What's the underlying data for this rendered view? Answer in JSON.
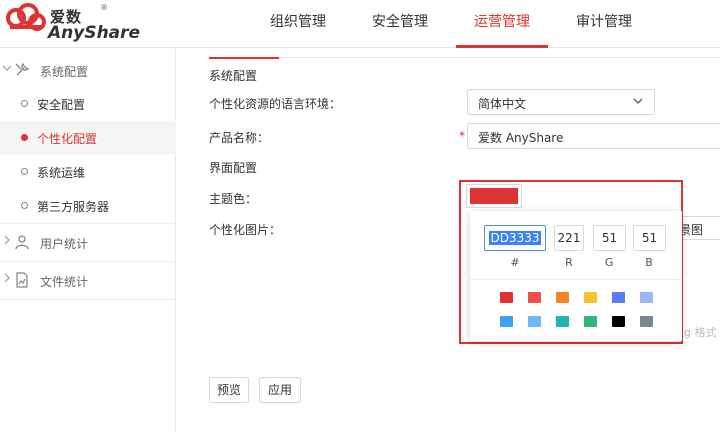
{
  "app": {
    "logo_cn": "爱数",
    "logo_en": "AnyShare",
    "logo_reg": "®"
  },
  "nav": {
    "items": [
      {
        "label": "组织管理"
      },
      {
        "label": "安全管理"
      },
      {
        "label": "运营管理"
      },
      {
        "label": "审计管理"
      }
    ],
    "active_index": 2
  },
  "sidebar": {
    "groups": [
      {
        "label": "系统配置",
        "icon": "tools-icon",
        "expanded": true
      },
      {
        "label": "用户统计",
        "icon": "user-icon",
        "expanded": false
      },
      {
        "label": "文件统计",
        "icon": "file-chart-icon",
        "expanded": false
      }
    ],
    "items": [
      {
        "label": "安全配置",
        "active": false
      },
      {
        "label": "个性化配置",
        "active": true
      },
      {
        "label": "系统运维",
        "active": false
      },
      {
        "label": "第三方服务器",
        "active": false
      }
    ]
  },
  "main": {
    "section_title": "系统配置",
    "language_label": "个性化资源的语言环境：",
    "language_value": "简体中文",
    "product_name_label": "产品名称：",
    "product_name_required": "*",
    "product_name_value": "爱数 AnyShare",
    "ui_config_label": "界面配置",
    "theme_label": "主题色：",
    "image_label": "个性化图片：",
    "background_partial": "景图",
    "hint_partial": "ng 格式",
    "preview_button": "预览",
    "apply_button": "应用"
  },
  "color_picker": {
    "current_color": "#dd3333",
    "hex_value": "DD3333",
    "r_value": "221",
    "g_value": "51",
    "b_value": "51",
    "hex_label": "#",
    "r_label": "R",
    "g_label": "G",
    "b_label": "B",
    "presets": [
      "#dd3333",
      "#f04e4e",
      "#f5871f",
      "#f7c230",
      "#5c7cf2",
      "#9db4f6",
      "#3fa0f2",
      "#6cb8f4",
      "#1fb5b0",
      "#31b77a",
      "#000000",
      "#7b8691"
    ]
  },
  "colors": {
    "accent": "#dd3333",
    "annotation_frame": "#dd3333"
  }
}
